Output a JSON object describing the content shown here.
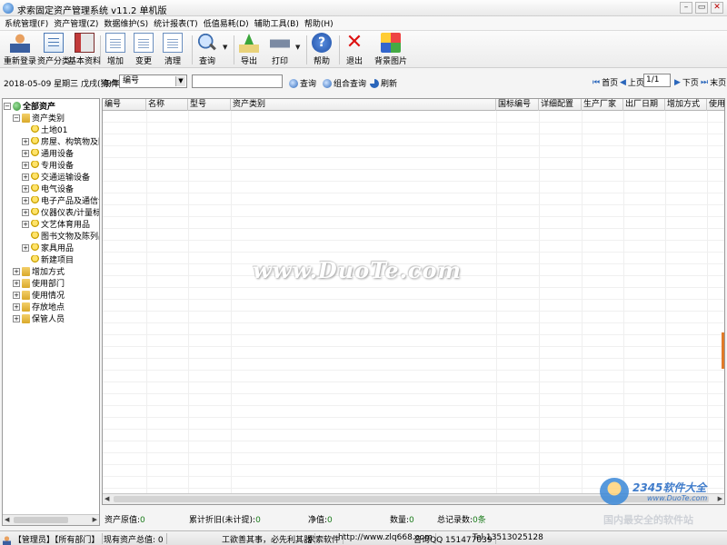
{
  "window": {
    "title": "求索固定资产管理系统 v11.2 单机版",
    "buttons": {
      "minimize": "–",
      "restore": "▭",
      "close": "✕"
    }
  },
  "menu": [
    "系统管理(F)",
    "资产管理(Z)",
    "数据维护(S)",
    "统计报表(T)",
    "低值易耗(D)",
    "辅助工具(B)",
    "帮助(H)"
  ],
  "toolbar": {
    "relogin": "重新登录",
    "asset_category": "资产分类",
    "basic_info": "基本资料",
    "add": "增加",
    "change": "变更",
    "clear": "清理",
    "query": "查询",
    "export": "导出",
    "print": "打印",
    "help": "帮助",
    "exit": "退出",
    "background": "背景图片"
  },
  "filter": {
    "date": "2018-05-09 星期三 戊戌(狗)年",
    "condition_label": "条件",
    "condition_value": "编号",
    "search_value": "",
    "query_btn": "查询",
    "combo_query_btn": "组合查询",
    "refresh_btn": "刷新"
  },
  "pager": {
    "first": "首页",
    "prev": "上页",
    "page": "1/1",
    "next": "下页",
    "last": "末页"
  },
  "tree": {
    "root": "全部资产",
    "category_group": "资产类别",
    "categories": [
      "土地01",
      "房屋、构筑物及附属",
      "通用设备",
      "专用设备",
      "交通运输设备",
      "电气设备",
      "电子产品及通信设备",
      "仪器仪表/计量标准",
      "文艺体育用品",
      "图书文物及陈列品",
      "家具用品",
      "新建项目"
    ],
    "groups": [
      "增加方式",
      "使用部门",
      "使用情况",
      "存放地点",
      "保管人员"
    ]
  },
  "grid": {
    "columns": [
      "编号",
      "名称",
      "型号",
      "资产类别",
      "国标编号",
      "详细配置",
      "生产厂家",
      "出厂日期",
      "增加方式",
      "使用部"
    ]
  },
  "summary": {
    "original_value_label": "资产原值:",
    "original_value": "0",
    "depreciation_label": "累计折旧(未计提):",
    "depreciation": "0",
    "net_value_label": "净值:",
    "net_value": "0",
    "quantity_label": "数量:",
    "quantity": "0",
    "record_count_label": "总记录数:",
    "record_count": "0条"
  },
  "status": {
    "user": "【管理员】【所有部门】",
    "total": "现有资产总值: 0",
    "motto": "工欲善其事，必先利其器",
    "company": "求索软件",
    "website": "http://www.zlq668.com",
    "qq": "咨询QQ 151477039",
    "tel": "Tel.13513025128"
  },
  "watermark": "www.DuoTe.com",
  "brand": {
    "name": "2345软件大全",
    "url": "www.DuoTe.com",
    "faded": "国内最安全的软件站"
  }
}
